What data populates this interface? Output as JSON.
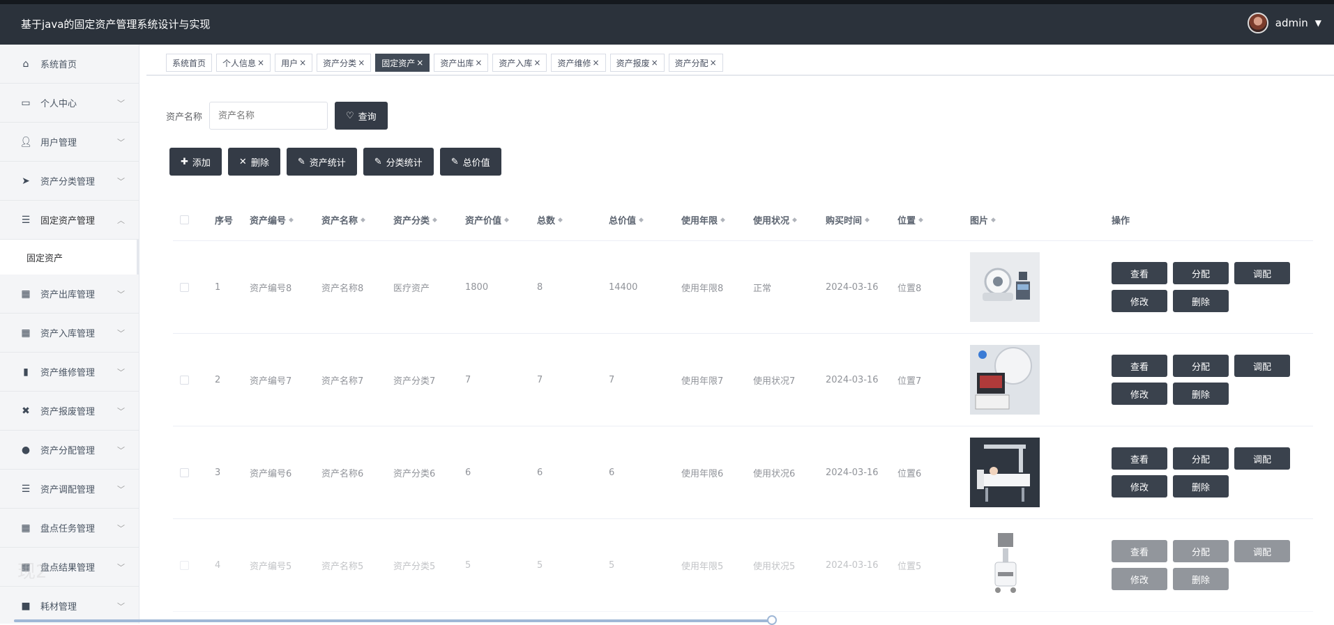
{
  "header": {
    "title": "基于java的固定资产管理系统设计与实现",
    "user": "admin"
  },
  "sidebar": {
    "items": [
      {
        "label": "系统首页",
        "icon": "home-icon"
      },
      {
        "label": "个人中心",
        "icon": "card-icon"
      },
      {
        "label": "用户管理",
        "icon": "user-icon"
      },
      {
        "label": "资产分类管理",
        "icon": "send-icon"
      },
      {
        "label": "固定资产管理",
        "icon": "list-icon"
      },
      {
        "label": "资产出库管理",
        "icon": "grid-icon"
      },
      {
        "label": "资产入库管理",
        "icon": "grid-icon"
      },
      {
        "label": "资产维修管理",
        "icon": "chart-icon"
      },
      {
        "label": "资产报废管理",
        "icon": "ticket-icon"
      },
      {
        "label": "资产分配管理",
        "icon": "pin-icon"
      },
      {
        "label": "资产调配管理",
        "icon": "list-icon"
      },
      {
        "label": "盘点任务管理",
        "icon": "grid-icon"
      },
      {
        "label": "盘点结果管理",
        "icon": "grid-icon"
      },
      {
        "label": "耗材管理",
        "icon": "box-icon"
      }
    ],
    "sub_item": "固定资产"
  },
  "tabs": [
    "系统首页",
    "个人信息",
    "用户",
    "资产分类",
    "固定资产",
    "资产出库",
    "资产入库",
    "资产维修",
    "资产报废",
    "资产分配"
  ],
  "search": {
    "label": "资产名称",
    "placeholder": "资产名称",
    "button": "查询"
  },
  "actions": {
    "add": "添加",
    "delete": "删除",
    "asset_stats": "资产统计",
    "category_stats": "分类统计",
    "total_value": "总价值"
  },
  "table": {
    "columns": [
      "序号",
      "资产编号",
      "资产名称",
      "资产分类",
      "资产价值",
      "总数",
      "总价值",
      "使用年限",
      "使用状况",
      "购买时间",
      "位置",
      "图片",
      "操作"
    ],
    "rows": [
      {
        "idx": "1",
        "code": "资产编号8",
        "name": "资产名称8",
        "cat": "医疗资产",
        "val": "1800",
        "cnt": "8",
        "tot": "14400",
        "life": "使用年限8",
        "stat": "正常",
        "date": "2024-03-16",
        "pos": "位置8"
      },
      {
        "idx": "2",
        "code": "资产编号7",
        "name": "资产名称7",
        "cat": "资产分类7",
        "val": "7",
        "cnt": "7",
        "tot": "7",
        "life": "使用年限7",
        "stat": "使用状况7",
        "date": "2024-03-16",
        "pos": "位置7"
      },
      {
        "idx": "3",
        "code": "资产编号6",
        "name": "资产名称6",
        "cat": "资产分类6",
        "val": "6",
        "cnt": "6",
        "tot": "6",
        "life": "使用年限6",
        "stat": "使用状况6",
        "date": "2024-03-16",
        "pos": "位置6"
      },
      {
        "idx": "4",
        "code": "资产编号5",
        "name": "资产名称5",
        "cat": "资产分类5",
        "val": "5",
        "cnt": "5",
        "tot": "5",
        "life": "使用年限5",
        "stat": "使用状况5",
        "date": "2024-03-16",
        "pos": "位置5"
      }
    ],
    "ops": {
      "view": "查看",
      "assign": "分配",
      "transfer": "调配",
      "edit": "修改",
      "delete": "删除"
    }
  },
  "overlay": "现2"
}
